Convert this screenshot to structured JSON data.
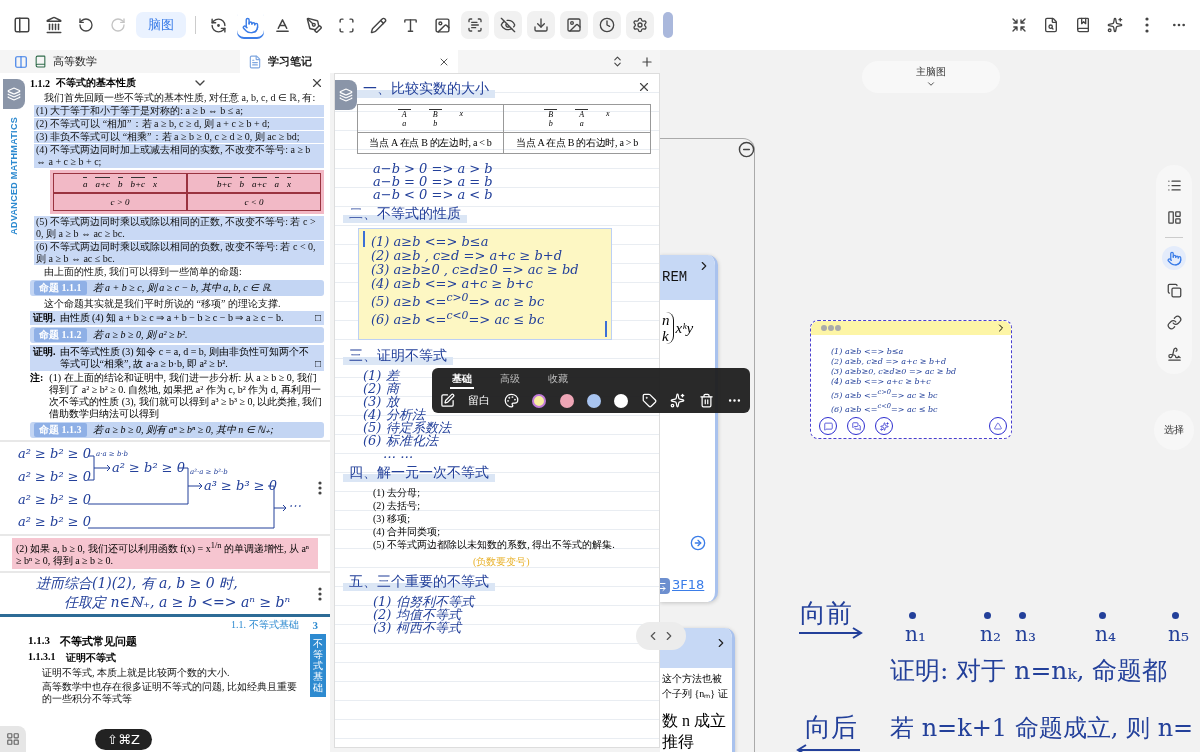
{
  "toolbar": {
    "mode_button": "脑图",
    "redo_disabled": true,
    "tools": [
      {
        "kind": "rotate",
        "selected": false
      },
      {
        "kind": "pointer",
        "selected": true
      },
      {
        "kind": "text",
        "selected": false
      },
      {
        "kind": "lasso",
        "selected": false
      },
      {
        "kind": "crop",
        "selected": false
      },
      {
        "kind": "pencil",
        "selected": false
      },
      {
        "kind": "textbox",
        "selected": false
      },
      {
        "kind": "image",
        "selected": false
      }
    ]
  },
  "tabs": [
    {
      "label": "高等数学",
      "selected": false
    },
    {
      "label": "学习笔记",
      "selected": true
    }
  ],
  "pdf": {
    "side_label": "ADVANCED MATHMATICS",
    "section": "1.1.2",
    "title": "不等式的基本性质",
    "blocks": [
      {
        "kind": "para",
        "text": "我们首先回顾一些不等式的基本性质, 对任意 a, b, c, d ∈ ℝ, 有:"
      },
      {
        "kind": "item",
        "text": "(1) 大于等于和小于等于是对称的: a ≥ b ⇔ b ≤ a;",
        "highlighted": true
      },
      {
        "kind": "item",
        "text": "(2) 不等式可以 “相加”：若 a ≥ b, c ≥ d, 则 a + c ≥ b + d;",
        "highlighted": true
      },
      {
        "kind": "item",
        "text": "(3) 非负不等式可以 “相乘”：若 a ≥ b ≥ 0, c ≥ d ≥ 0, 则 ac ≥ bd;",
        "highlighted": true
      },
      {
        "kind": "item",
        "text": "(4) 不等式两边同时加上或减去相同的实数, 不改变不等号: a ≥ b ⇔ a + c ≥ b + c;",
        "highlighted": true
      },
      {
        "kind": "table",
        "left_axis": [
          "a",
          "a+c",
          "b",
          "b+c",
          "x"
        ],
        "right_axis": [
          "b+c",
          "b",
          "a+c",
          "a",
          "x"
        ],
        "conditions": [
          "c > 0",
          "c < 0"
        ]
      },
      {
        "kind": "item",
        "text": "(5) 不等式两边同时乘以或除以相同的正数, 不改变不等号: 若 c > 0, 则 a ≥ b ⇔ ac ≥ bc.",
        "highlighted": true
      },
      {
        "kind": "item",
        "text": "(6) 不等式两边同时乘以或除以相同的负数, 改变不等号: 若 c < 0, 则 a ≥ b ⇔ ac ≤ bc.",
        "highlighted": true
      },
      {
        "kind": "para",
        "text": "由上面的性质, 我们可以得到一些简单的命题:"
      },
      {
        "kind": "callout",
        "label": "命题 1.1.1",
        "text": "若 a + b ≥ c, 则 a ≥ c − b, 其中 a, b, c ∈ ℝ."
      },
      {
        "kind": "para",
        "text": "这个命题其实就是我们平时所说的 “移项” 的理论支撑."
      },
      {
        "kind": "proof",
        "label": "证明.",
        "text": "由性质 (4) 知 a + b ≥ c ⇒ a + b − b ≥ c − b ⇒ a ≥ c − b.",
        "end_mark": "□"
      },
      {
        "kind": "callout",
        "label": "命题 1.1.2",
        "text": "若 a ≥ b ≥ 0, 则 a² ≥ b²."
      },
      {
        "kind": "proof",
        "label": "证明.",
        "text": "由不等式性质 (3) 知令 c = a, d = b, 则由非负性可知两个不等式可以“相乘”, 故 a·a ≥ b·b, 即 a² ≥ b².",
        "end_mark": "□"
      },
      {
        "kind": "note",
        "label": "注:",
        "text": "(1) 在上面的结论和证明中, 我们进一步分析: 从 a ≥ b ≥ 0, 我们得到了 a² ≥ b² ≥ 0. 自然地, 如果把 a² 作为 c, b² 作为 d, 再利用一次不等式的性质 (3), 我们就可以得到 a³ ≥ b³ ≥ 0, 以此类推, 我们借助数学归纳法可以得到"
      },
      {
        "kind": "callout",
        "label": "命题 1.1.3",
        "text": "若 a ≥ b ≥ 0, 则有 aⁿ ≥ bⁿ ≥ 0, 其中 n ∈ ℕ₊;"
      }
    ]
  },
  "pdf_lower": {
    "diagram": {
      "rows": [
        "a² ≥ b² ≥ 0",
        "a² ≥ b² ≥ 0",
        "a² ≥ b² ≥ 0",
        "a² ≥ b² ≥ 0"
      ],
      "steps": [
        {
          "note": "a·a ≥ b·b",
          "result": "a² ≥ b² ≥ 0"
        },
        {
          "note": "a²·a ≥ b²·b",
          "result": "a³ ≥ b³ ≥ 0"
        }
      ],
      "end": "⋯"
    },
    "pink_note": "(2) 如果 a, b ≥ 0, 我们还可以利用函数 f(x) = x$^{1/n}$ 的单调递增性, 从 aⁿ ≥ bⁿ ≥ 0, 得到 a ≥ b ≥ 0.",
    "hand_lines": [
      "进而综合(1)(2), 有 a, b ≥ 0 时,",
      "任取定 n∈ℕ₊, a ≥ b <=> aⁿ ≥ bⁿ"
    ],
    "running_title": "1.1. 不等式基础",
    "page": "3",
    "heading_number": "1.1.3",
    "heading": "不等式常见问题",
    "subheading_number": "1.1.3.1",
    "subheading": "证明不等式",
    "paragraphs": [
      "证明不等式, 本质上就是比较两个数的大小.",
      "高等数学中也存在很多证明不等式的问题, 比如经典且重要的一些积分不等式等"
    ],
    "side_tab": "不等式基础",
    "shortcut": "⇧⌘Z"
  },
  "notes": {
    "blocks": [
      {
        "kind": "heading",
        "text": "一、比较实数的大小"
      },
      {
        "kind": "table",
        "cells": [
          {
            "points": [
              {
                "upper": "A",
                "lower": "a"
              },
              {
                "upper": "B",
                "lower": "b"
              }
            ],
            "axis": "x",
            "caption": "当点 A 在点 B 的左边时, a < b"
          },
          {
            "points": [
              {
                "upper": "B",
                "lower": "b"
              },
              {
                "upper": "A",
                "lower": "a"
              }
            ],
            "axis": "x",
            "caption": "当点 A 在点 B 的右边时, a > b"
          }
        ]
      },
      {
        "kind": "hand",
        "lines": [
          "a−b > 0  =>  a > b",
          "a−b = 0  =>  a = b",
          "a−b < 0  =>  a < b"
        ]
      },
      {
        "kind": "heading",
        "text": "二、不等式的性质"
      },
      {
        "kind": "sticky",
        "selected": true,
        "lines": [
          "(1) a≥b  <=>  b≤a",
          "(2) a≥b , c≥d =>  a+c ≥ b+d",
          "(3) a≥b≥0 , c≥d≥0  =>  ac ≥ bd",
          "(4) a≥b  <=>  a+c ≥ b+c",
          "(5) a≥b <=$^{c>0}$=> ac ≥ bc",
          "(6) a≥b <=$^{c<0}$=> ac ≤ bc"
        ]
      },
      {
        "kind": "heading",
        "text": "三、证明不等式"
      },
      {
        "kind": "hand",
        "lines": [
          "(1) 差",
          "(2) 商",
          "(3) 放",
          "(4) 分析法",
          "(5) 待定系数法",
          "(6) 标准化法",
          "… …"
        ]
      },
      {
        "kind": "heading",
        "text": "四、解一元一次不等式"
      },
      {
        "kind": "list",
        "items": [
          "(1) 去分母;",
          "(2) 去括号;",
          "(3) 移项;",
          "(4) 合并同类项;",
          "(5) 不等式两边都除以未知数的系数, 得出不等式的解集."
        ],
        "annotation": "(负数要变号)"
      },
      {
        "kind": "heading",
        "text": "五、三个重要的不等式"
      },
      {
        "kind": "hand",
        "lines": [
          "(1) 伯努利不等式",
          "(2) 均值不等式",
          "(3) 柯西不等式"
        ]
      }
    ]
  },
  "popup": {
    "tabs": [
      {
        "label": "基础",
        "selected": true
      },
      {
        "label": "高级",
        "selected": false
      },
      {
        "label": "收藏",
        "selected": false
      }
    ],
    "blank_label": "留白",
    "colors": [
      {
        "color": "#f8eea0",
        "selected": true
      },
      {
        "color": "#eea6b6",
        "selected": false
      },
      {
        "color": "#a8c4f0",
        "selected": false
      },
      {
        "color": "#ffffff",
        "selected": false
      }
    ]
  },
  "canvas": {
    "map_selector": "主脑图",
    "select_button": "选择",
    "side_tools": [
      {
        "kind": "outline",
        "selected": false
      },
      {
        "kind": "layout",
        "selected": false
      },
      {
        "kind": "pointer",
        "selected": true
      },
      {
        "kind": "copy",
        "selected": false
      },
      {
        "kind": "link",
        "selected": false
      },
      {
        "kind": "stroke",
        "selected": false
      }
    ],
    "theorem_card": {
      "title": "REM",
      "binom_top": "n",
      "binom_bottom": "k",
      "term": "xᵏy",
      "link": "3F18"
    },
    "lower_card": {
      "small_lines": [
        "这个方法也被",
        "个子列 {nₘ} 证"
      ],
      "big_lines": [
        "数 n 成立",
        "推得"
      ]
    },
    "mini_card": {
      "lines": [
        "(1) a≥b <=> b≤a",
        "(2) a≥b, c≥d => a+c ≥ b+d",
        "(3) a≥b≥0, c≥d≥0 => ac ≥ bd",
        "(4) a≥b <=> a+c ≥ b+c",
        "(5) a≥b <=$^{c>0}$=> ac ≥ bc",
        "(6) a≥b <=$^{c<0}$=> ac ≤ bc"
      ]
    },
    "handwriting": {
      "forward": "向前",
      "backward": "向后",
      "points": [
        "n₁",
        "n₂",
        "n₃",
        "n₄",
        "n₅"
      ],
      "line_1": "证明: 对于 n=nₖ, 命题都",
      "line_2": "若 n=k+1 命题成立, 则 n="
    }
  }
}
